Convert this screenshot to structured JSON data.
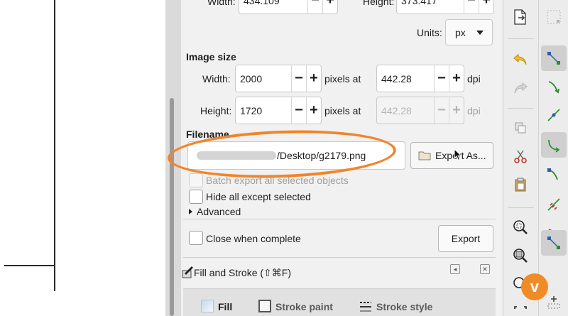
{
  "document_size": {
    "width_label": "Width:",
    "width_value": "434.109",
    "height_label": "Height:",
    "height_value": "373.417"
  },
  "units": {
    "label": "Units:",
    "value": "px"
  },
  "image_size": {
    "title": "Image size",
    "width_label": "Width:",
    "width_value": "2000",
    "width_unit": "pixels at",
    "width_dpi": "442.28",
    "height_label": "Height:",
    "height_value": "1720",
    "height_unit": "pixels at",
    "height_dpi": "442.28",
    "dpi_label": "dpi"
  },
  "filename": {
    "title": "Filename",
    "value_visible": "/Desktop/g2179.png",
    "export_as_label": "Export As..."
  },
  "options": {
    "batch_export": "Batch export all selected objects",
    "hide_all": "Hide all except selected",
    "advanced": "Advanced",
    "close_when_complete": "Close when complete"
  },
  "export_button": "Export",
  "fill_stroke": {
    "title": "Fill and Stroke (⇧⌘F)",
    "tabs": [
      {
        "label": "Fill",
        "active": true
      },
      {
        "label": "Stroke paint",
        "active": false
      },
      {
        "label": "Stroke style",
        "active": false
      }
    ]
  },
  "spin_minus": "−",
  "spin_plus": "+",
  "colors": {
    "highlight": "#f2842a",
    "panel_bg": "#f1f1f1",
    "toolbar_bg": "#ececec",
    "snap_green": "#2f8a2f",
    "snap_blue": "#2a5fa8"
  }
}
